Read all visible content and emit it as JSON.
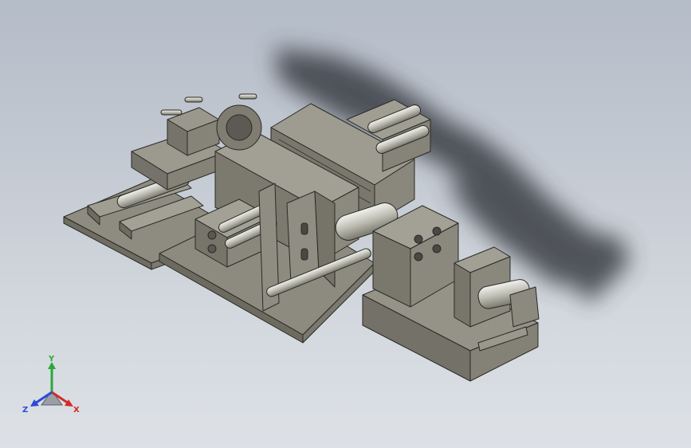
{
  "viewport": {
    "background_top": "#b4bcc8",
    "background_bottom": "#dde1e6",
    "model_color": "#8c8a7c",
    "model_edge_color": "#2a2a26",
    "shadow_color": "#3a3d44"
  },
  "triad": {
    "x_label": "X",
    "y_label": "Y",
    "z_label": "Z",
    "x_color": "#d42a2a",
    "y_color": "#2aa83a",
    "z_color": "#2a4bd4"
  }
}
